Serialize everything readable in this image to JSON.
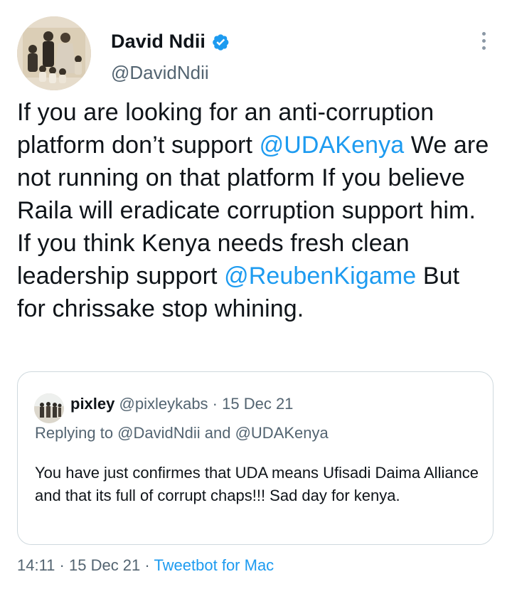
{
  "author": {
    "display_name": "David Ndii",
    "handle": "@DavidNdii",
    "verified_icon": "verified-badge-icon",
    "avatar_icon": "vintage-family-photo"
  },
  "menu": {
    "more_icon": "more-vertical-icon"
  },
  "tweet": {
    "text_parts": {
      "p1": "If you are looking for an anti-corruption platform don’t support ",
      "m1": "@UDAKenya",
      "p2": " We are not running on that platform If you believe Raila will eradicate corruption support him.  If you think Kenya needs fresh clean leadership support ",
      "m2": "@ReubenKigame",
      "p3": " But for chrissake stop whining."
    }
  },
  "quoted_tweet": {
    "display_name": "pixley",
    "handle": "@pixleykabs",
    "separator": " · ",
    "date": "15 Dec 21",
    "replying_to": "Replying to @DavidNdii and @UDAKenya",
    "body": "You have just confirmes that UDA means Ufisadi Daima Alliance and that its full of corrupt chaps!!! Sad day for kenya."
  },
  "footer": {
    "time": "14:11",
    "separator": " · ",
    "date": "15 Dec 21",
    "source": "Tweetbot for Mac"
  },
  "colors": {
    "accent": "#1d9bf0",
    "secondary_text": "#536471",
    "primary_text": "#0f1419",
    "border": "#cfd9de"
  }
}
